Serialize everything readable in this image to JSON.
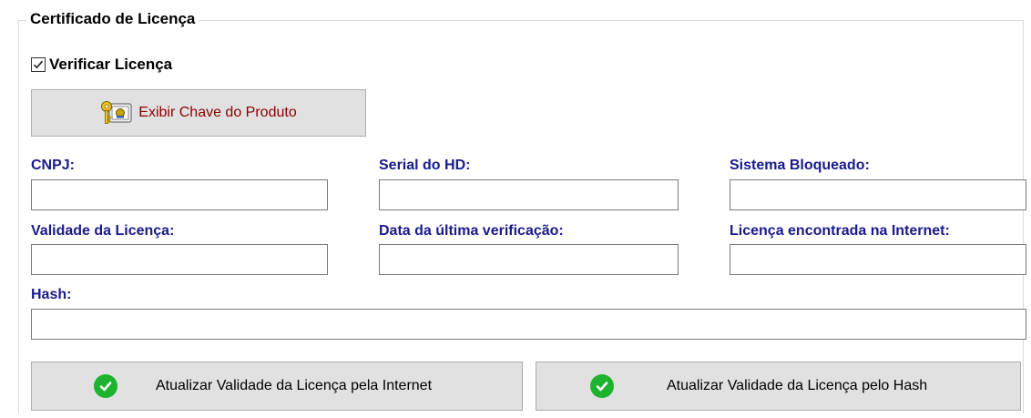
{
  "group": {
    "title": "Certificado de Licença"
  },
  "verify": {
    "label": "Verificar Licença",
    "checked": true
  },
  "product_key_button": {
    "label": "Exibir Chave do Produto",
    "icon": "key-certificate-icon"
  },
  "fields": {
    "cnpj": {
      "label": "CNPJ:",
      "value": ""
    },
    "serial_hd": {
      "label": "Serial do HD:",
      "value": ""
    },
    "sistema_bloqueado": {
      "label": "Sistema Bloqueado:",
      "value": ""
    },
    "validade": {
      "label": "Validade da Licença:",
      "value": ""
    },
    "ultima_verificacao": {
      "label": "Data da última verificação:",
      "value": ""
    },
    "licenca_internet": {
      "label": "Licença encontrada na Internet:",
      "value": ""
    },
    "hash": {
      "label": "Hash:",
      "value": ""
    }
  },
  "actions": {
    "internet_label": "Atualizar Validade da Licença pela Internet",
    "hash_label": "Atualizar Validade da Licença pelo Hash",
    "icon": "green-check-icon"
  },
  "colors": {
    "label_blue": "#1a1a8c",
    "key_button_text": "#8b0000",
    "check_green": "#1db32e",
    "button_face": "#e1e1e1"
  }
}
